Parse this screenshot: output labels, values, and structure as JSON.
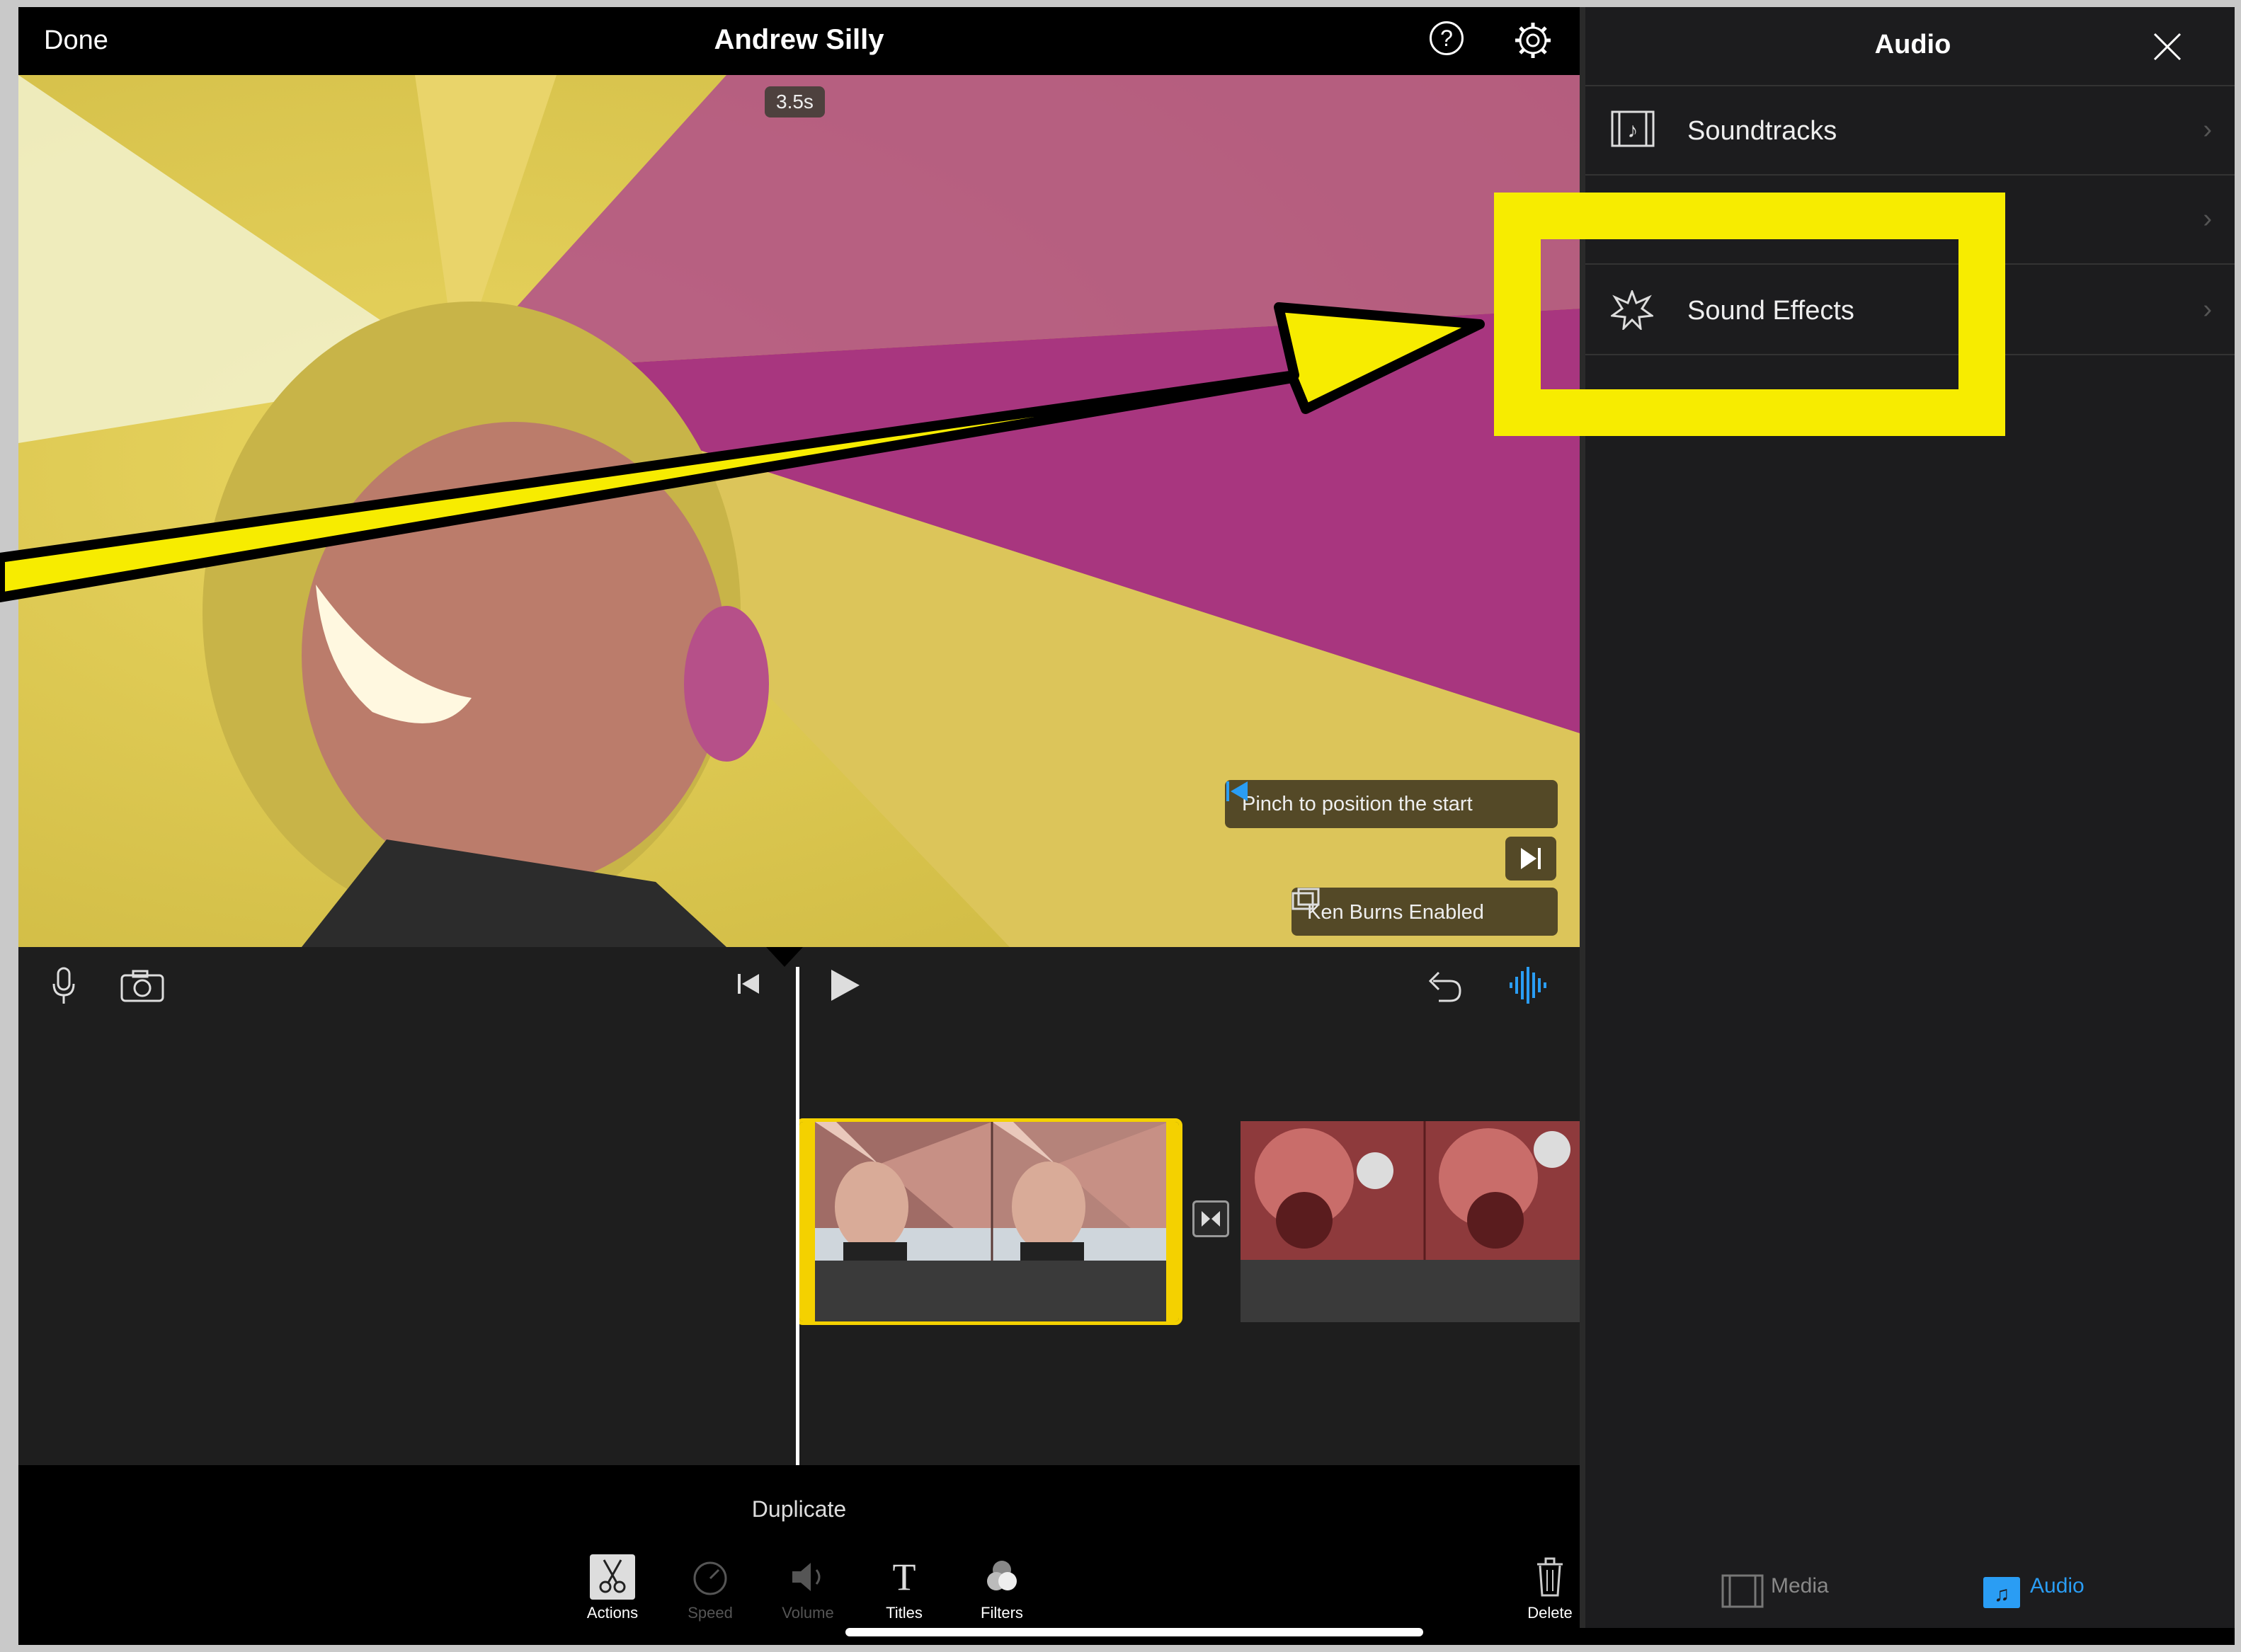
{
  "topbar": {
    "done_label": "Done",
    "project_title": "Andrew Silly"
  },
  "preview": {
    "duration_badge": "3.5s",
    "hint_pinch": "Pinch to position the start",
    "hint_ken_burns": "Ken Burns Enabled"
  },
  "timeline": {
    "selected_clip": "first clip",
    "action_label": "Duplicate"
  },
  "toolbar": {
    "actions_label": "Actions",
    "speed_label": "Speed",
    "volume_label": "Volume",
    "titles_label": "Titles",
    "filters_label": "Filters",
    "delete_label": "Delete"
  },
  "audio_panel": {
    "title": "Audio",
    "items": [
      {
        "label": "Soundtracks",
        "icon": "film-music-icon"
      },
      {
        "label": "",
        "icon": ""
      },
      {
        "label": "Sound Effects",
        "icon": "starburst-icon"
      }
    ],
    "tabs": [
      {
        "label": "Media",
        "active": false
      },
      {
        "label": "Audio",
        "active": true
      }
    ]
  },
  "colors": {
    "accent": "#2a9df4",
    "highlight": "#f7ec00",
    "clip_border": "#f4d100"
  }
}
